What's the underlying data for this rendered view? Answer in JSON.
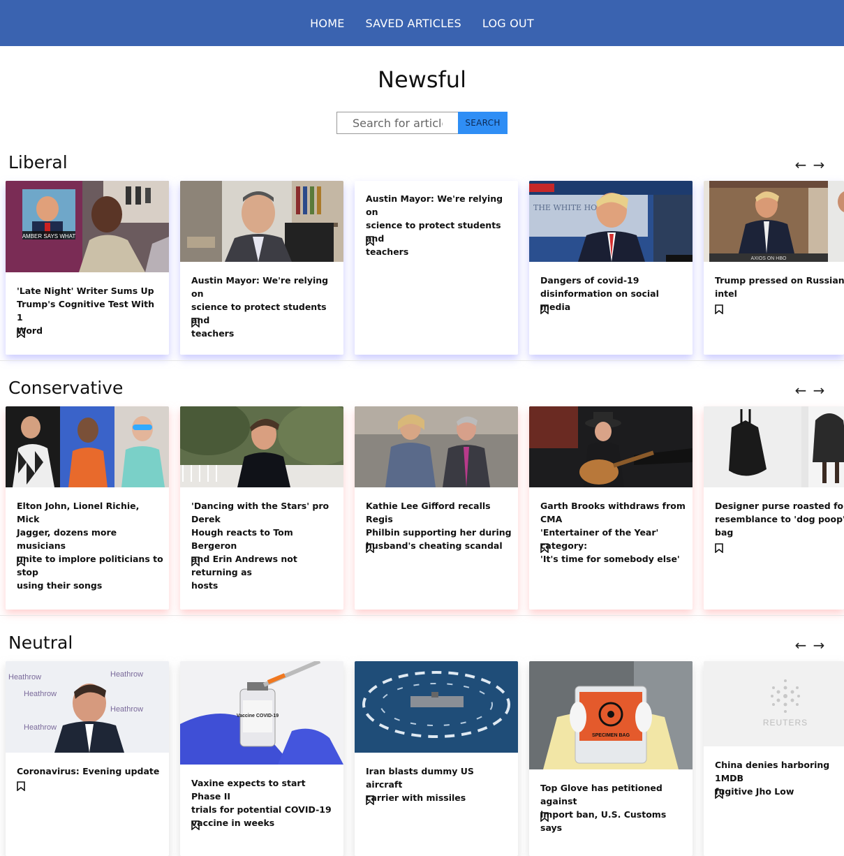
{
  "nav": {
    "home": "HOME",
    "saved": "SAVED ARTICLES",
    "logout": "LOG OUT"
  },
  "brand": "Newsful",
  "search": {
    "placeholder": "Search for articles",
    "button": "SEARCH"
  },
  "arrows": {
    "left": "←",
    "right": "→"
  },
  "colors": {
    "nav": "#3a63b0",
    "search_button": "#2f8ef5",
    "liberal_glow": "#c8c8ff",
    "conservative_glow": "#ffc8c8",
    "neutral_glow": "#dddddd"
  },
  "sections": [
    {
      "title": "Liberal",
      "cards": [
        {
          "headline": "'Late Night' Writer Sums Up\nTrump's Cognitive Test With 1\nWord",
          "image": "talk-show-photo",
          "overlay": "AMBER SAYS WHAT"
        },
        {
          "headline": "Austin Mayor: We're relying on\nscience to protect students and\nteachers",
          "image": "mayor-office-photo"
        },
        {
          "headline": "Austin Mayor: We're relying on\nscience to protect students and\nteachers",
          "image": ""
        },
        {
          "headline": "Dangers of covid-19\ndisinformation on social media",
          "image": "white-house-briefing-photo",
          "overlay": "THE WHITE HOUSE"
        },
        {
          "headline": "Trump pressed on Russian bounty\nintel",
          "image": "interview-photo",
          "overlay": "AXIOS ON HBO"
        }
      ]
    },
    {
      "title": "Conservative",
      "cards": [
        {
          "headline": "Elton John, Lionel Richie, Mick\nJagger, dozens more musicians\nunite to implore politicians to stop\nusing their songs",
          "image": "musicians-collage"
        },
        {
          "headline": "'Dancing with the Stars' pro Derek\nHough reacts to Tom Bergeron\nand Erin Andrews not returning as\nhosts",
          "image": "derek-hough-photo"
        },
        {
          "headline": "Kathie Lee Gifford recalls Regis\nPhilbin supporting her during\nhusband's cheating scandal",
          "image": "gifford-philbin-photo"
        },
        {
          "headline": "Garth Brooks withdraws from CMA\n'Entertainer of the Year' category:\n'It's time for somebody else'",
          "image": "guitar-performer-photo"
        },
        {
          "headline": "Designer purse roasted for\nresemblance to 'dog poop' waste\nbag",
          "image": "purse-photo"
        }
      ]
    },
    {
      "title": "Neutral",
      "cards": [
        {
          "headline": "Coronavirus: Evening update",
          "image": "heathrow-interview",
          "overlay": "Heathrow"
        },
        {
          "headline": "Vaxine expects to start Phase II\ntrials for potential COVID-19\nvaccine in weeks",
          "image": "vaccine-vial-photo",
          "overlay": "Vaccine COVID-19"
        },
        {
          "headline": "Iran blasts dummy US aircraft\ncarrier with missiles",
          "image": "aircraft-carrier-aerial"
        },
        {
          "headline": "Top Glove has petitioned against\nimport ban, U.S. Customs says",
          "image": "specimen-bag-photo",
          "overlay": "SPECIMEN BAG"
        },
        {
          "headline": "China denies harboring 1MDB\nfugitive Jho Low",
          "image": "reuters-placeholder",
          "overlay": "REUTERS"
        }
      ]
    }
  ]
}
